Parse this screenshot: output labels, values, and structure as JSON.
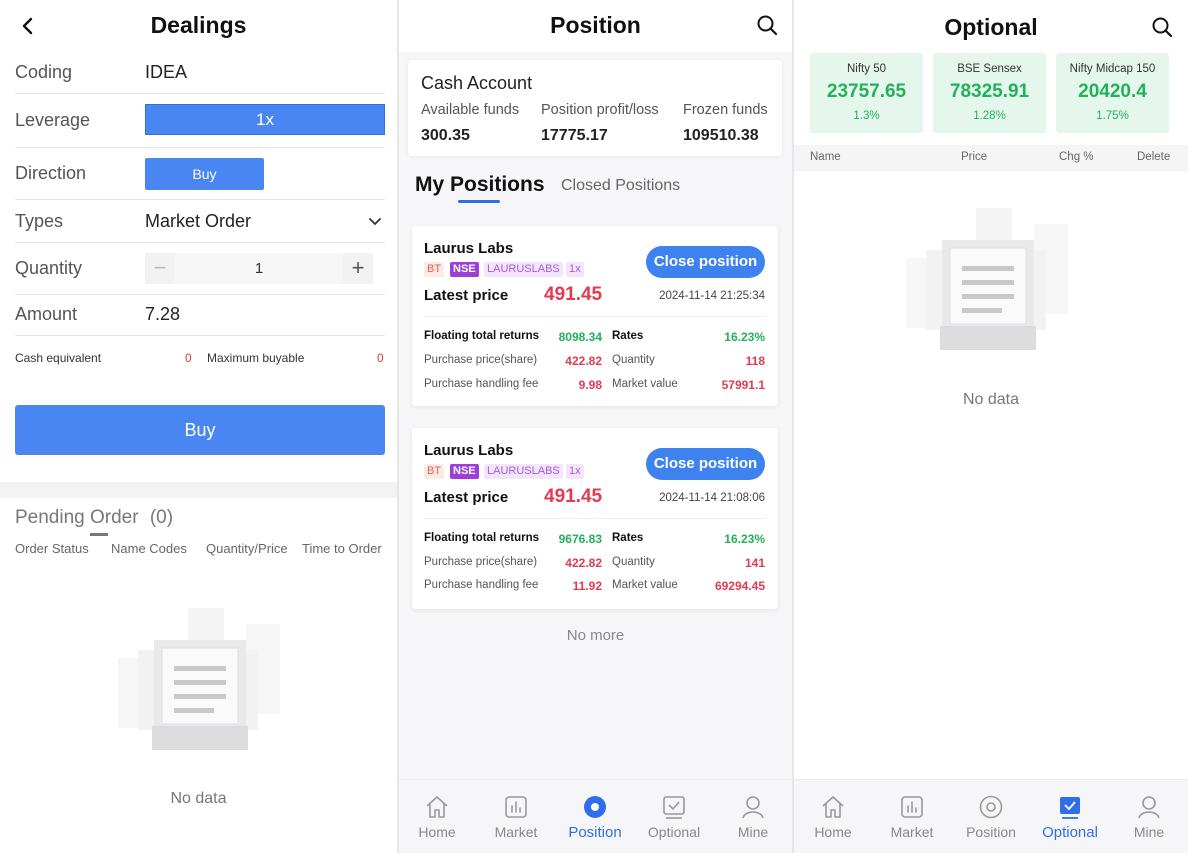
{
  "dealings": {
    "title": "Dealings",
    "coding_label": "Coding",
    "coding_value": "IDEA",
    "leverage_label": "Leverage",
    "leverage_value": "1x",
    "direction_label": "Direction",
    "direction_value": "Buy",
    "types_label": "Types",
    "types_value": "Market Order",
    "quantity_label": "Quantity",
    "quantity_value": "1",
    "amount_label": "Amount",
    "amount_value": "7.28",
    "cash_equivalent_label": "Cash equivalent",
    "cash_equivalent_value": "0",
    "max_buyable_label": "Maximum buyable",
    "max_buyable_value": "0",
    "buy_button": "Buy",
    "pending_title": "Pending Order",
    "pending_count": "(0)",
    "columns": [
      "Order Status",
      "Name Codes",
      "Quantity/Price",
      "Time to Order"
    ],
    "empty_text": "No data"
  },
  "position": {
    "title": "Position",
    "cash_account_title": "Cash Account",
    "available_funds_label": "Available funds",
    "available_funds_value": "300.35",
    "profit_loss_label": "Position profit/loss",
    "profit_loss_value": "17775.17",
    "frozen_funds_label": "Frozen funds",
    "frozen_funds_value": "109510.38",
    "tab_my": "My Positions",
    "tab_closed": "Closed Positions",
    "cards": [
      {
        "name": "Laurus Labs",
        "tag_bt": "BT",
        "tag_exchange": "NSE",
        "tag_code": "LAURUSLABS",
        "tag_leverage": "1x",
        "close_label": "Close position",
        "latest_price_label": "Latest price",
        "latest_price": "491.45",
        "time": "2024-11-14 21:25:34",
        "floating_label": "Floating total returns",
        "floating_value": "8098.34",
        "rates_label": "Rates",
        "rates_value": "16.23%",
        "purchase_price_label": "Purchase price(share)",
        "purchase_price_value": "422.82",
        "quantity_label": "Quantity",
        "quantity_value": "118",
        "handling_fee_label": "Purchase handling fee",
        "handling_fee_value": "9.98",
        "market_value_label": "Market value",
        "market_value_value": "57991.1"
      },
      {
        "name": "Laurus Labs",
        "tag_bt": "BT",
        "tag_exchange": "NSE",
        "tag_code": "LAURUSLABS",
        "tag_leverage": "1x",
        "close_label": "Close position",
        "latest_price_label": "Latest price",
        "latest_price": "491.45",
        "time": "2024-11-14 21:08:06",
        "floating_label": "Floating total returns",
        "floating_value": "9676.83",
        "rates_label": "Rates",
        "rates_value": "16.23%",
        "purchase_price_label": "Purchase price(share)",
        "purchase_price_value": "422.82",
        "quantity_label": "Quantity",
        "quantity_value": "141",
        "handling_fee_label": "Purchase handling fee",
        "handling_fee_value": "11.92",
        "market_value_label": "Market value",
        "market_value_value": "69294.45"
      }
    ],
    "no_more": "No more"
  },
  "optional": {
    "title": "Optional",
    "indices": [
      {
        "name": "Nifty 50",
        "value": "23757.65",
        "change": "1.3%"
      },
      {
        "name": "BSE Sensex",
        "value": "78325.91",
        "change": "1.28%"
      },
      {
        "name": "Nifty Midcap 150",
        "value": "20420.4",
        "change": "1.75%"
      }
    ],
    "columns": [
      "Name",
      "Price",
      "Chg %",
      "Delete"
    ],
    "empty_text": "No data"
  },
  "tabbar": {
    "home": "Home",
    "market": "Market",
    "position": "Position",
    "optional": "Optional",
    "mine": "Mine"
  },
  "colors": {
    "accent": "#2f6ee8",
    "button_blue": "#4a86f2",
    "gain_green": "#22b05a",
    "loss_red": "#e53950",
    "index_card_bg": "#e5f7ec"
  }
}
